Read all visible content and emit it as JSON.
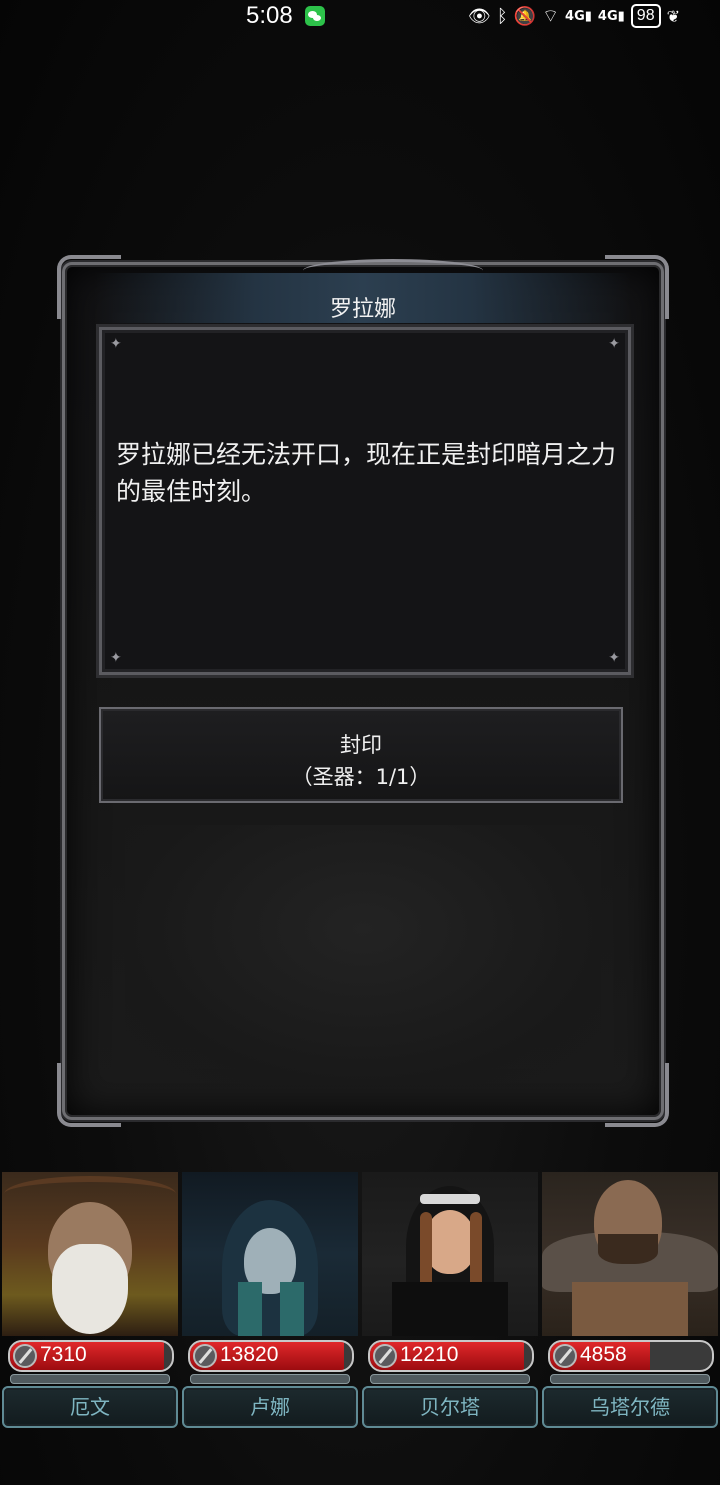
{
  "status_bar": {
    "time": "5:08",
    "network_1": "4G",
    "network_2": "4G",
    "battery": "98"
  },
  "dialog": {
    "speaker": "罗拉娜",
    "text": "罗拉娜已经无法开口，现在正是封印暗月之力的最佳时刻。",
    "choice": {
      "line1": "封印",
      "line2": "（圣器：1/1）"
    }
  },
  "party": [
    {
      "name": "厄文",
      "hp": "7310",
      "hp_fraction": 0.95
    },
    {
      "name": "卢娜",
      "hp": "13820",
      "hp_fraction": 0.95
    },
    {
      "name": "贝尔塔",
      "hp": "12210",
      "hp_fraction": 0.95
    },
    {
      "name": "乌塔尔德",
      "hp": "4858",
      "hp_fraction": 0.62
    }
  ],
  "colors": {
    "hp_red": "#d41e22",
    "name_teal": "#7fb6c2",
    "frame_steel": "#6e6e72"
  }
}
